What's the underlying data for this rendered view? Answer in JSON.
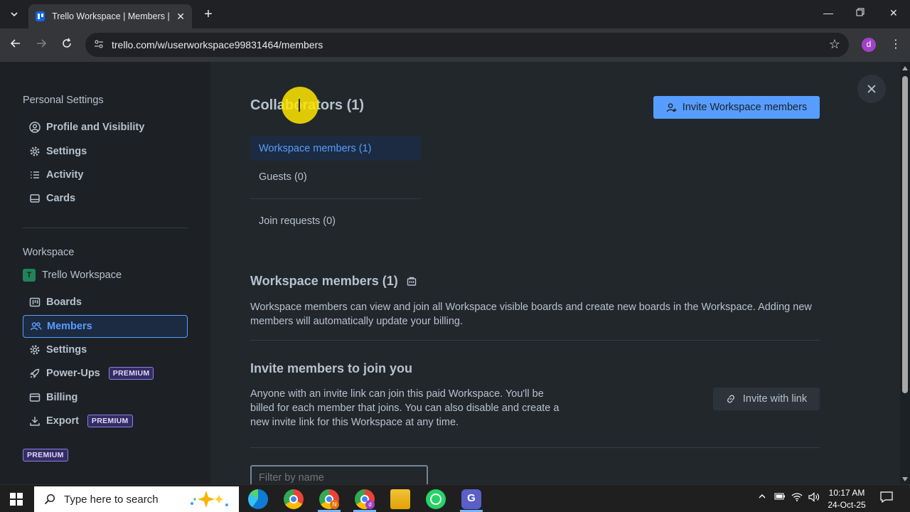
{
  "browser": {
    "tab_title": "Trello Workspace | Members | Tr",
    "url": "trello.com/w/userworkspace99831464/members",
    "profile_initial": "d"
  },
  "sidebar": {
    "personal_title": "Personal Settings",
    "personal_items": [
      {
        "label": "Profile and Visibility",
        "icon": "user-circle-icon"
      },
      {
        "label": "Settings",
        "icon": "gear-icon"
      },
      {
        "label": "Activity",
        "icon": "list-icon"
      },
      {
        "label": "Cards",
        "icon": "card-icon"
      }
    ],
    "workspace_title": "Workspace",
    "workspace_name": "Trello Workspace",
    "workspace_initial": "T",
    "workspace_items": [
      {
        "label": "Boards",
        "icon": "boards-icon"
      },
      {
        "label": "Members",
        "icon": "members-icon",
        "active": true
      },
      {
        "label": "Settings",
        "icon": "gear-icon"
      },
      {
        "label": "Power-Ups",
        "icon": "rocket-icon",
        "badge": "PREMIUM"
      },
      {
        "label": "Billing",
        "icon": "credit-card-icon"
      },
      {
        "label": "Export",
        "icon": "download-icon",
        "badge": "PREMIUM"
      }
    ],
    "footer_badge": "PREMIUM"
  },
  "main": {
    "title": "Collaborators (1)",
    "invite_button": "Invite Workspace members",
    "tabs": [
      "Workspace members (1)",
      "Guests (0)",
      "Join requests (0)"
    ],
    "members_heading": "Workspace members (1)",
    "members_desc": "Workspace members can view and join all Workspace visible boards and create new boards in the Workspace. Adding new members will automatically update your billing.",
    "invite_heading": "Invite members to join you",
    "invite_desc": "Anyone with an invite link can join this paid Workspace. You'll be billed for each member that joins. You can also disable and create a new invite link for this Workspace at any time.",
    "invite_link_button": "Invite with link",
    "filter_placeholder": "Filter by name"
  },
  "taskbar": {
    "search_placeholder": "Type here to search",
    "time": "10:17 AM",
    "date": "24-Oct-25"
  },
  "colors": {
    "accent": "#579dff",
    "background": "#1d2125",
    "main_bg": "#22272b",
    "premium": "#8f7ee7"
  }
}
